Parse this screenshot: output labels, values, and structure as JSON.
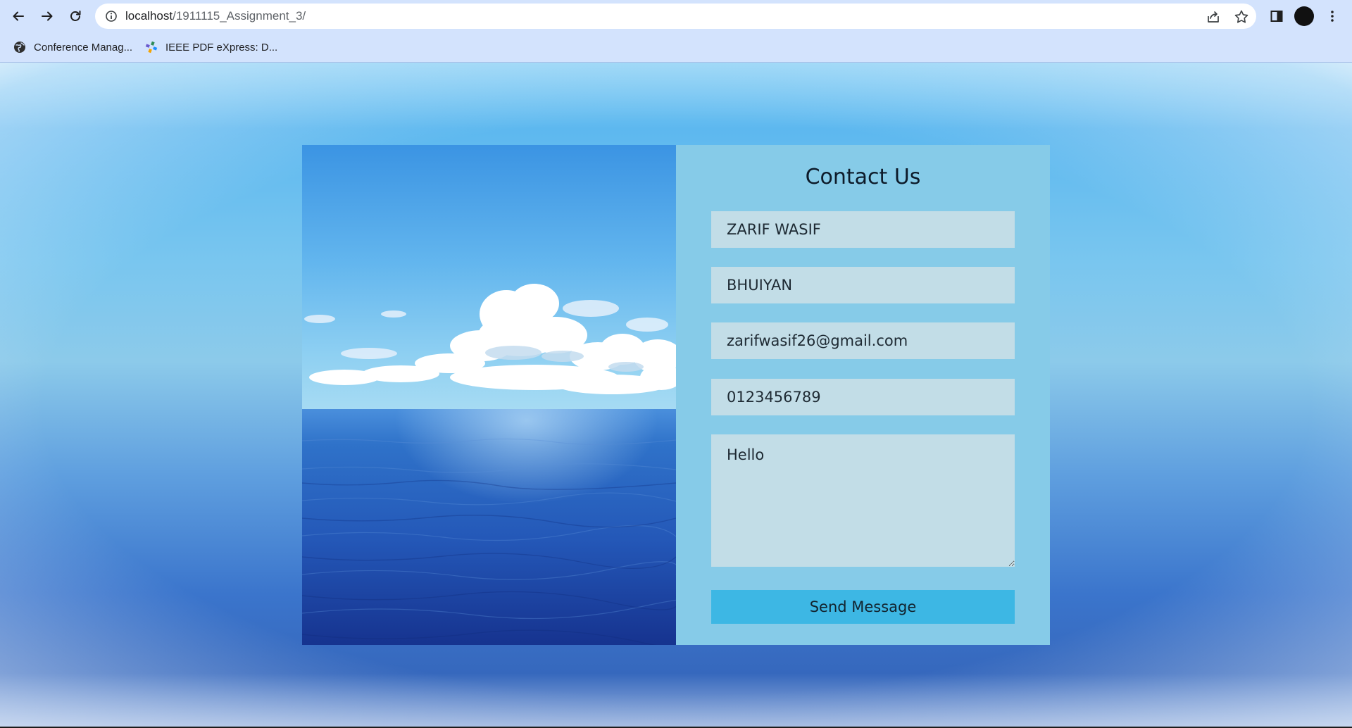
{
  "browser": {
    "url_host": "localhost",
    "url_path": "/1911115_Assignment_3/",
    "bookmarks": [
      {
        "label": "Conference Manag...",
        "icon": "globe-icon"
      },
      {
        "label": "IEEE PDF eXpress: D...",
        "icon": "ieee-pinwheel-icon"
      }
    ],
    "profile_color": "#111111"
  },
  "page": {
    "image": {
      "subject": "ocean-horizon-with-clouds"
    },
    "form": {
      "title": "Contact Us",
      "first_name": "ZARIF WASIF",
      "last_name": "BHUIYAN",
      "email": "zarifwasif26@gmail.com",
      "phone": "0123456789",
      "message": "Hello",
      "submit_label": "Send Message"
    },
    "colors": {
      "panel": "#86cbe8",
      "field": "#c2dde7",
      "button": "#3db7e4"
    }
  }
}
